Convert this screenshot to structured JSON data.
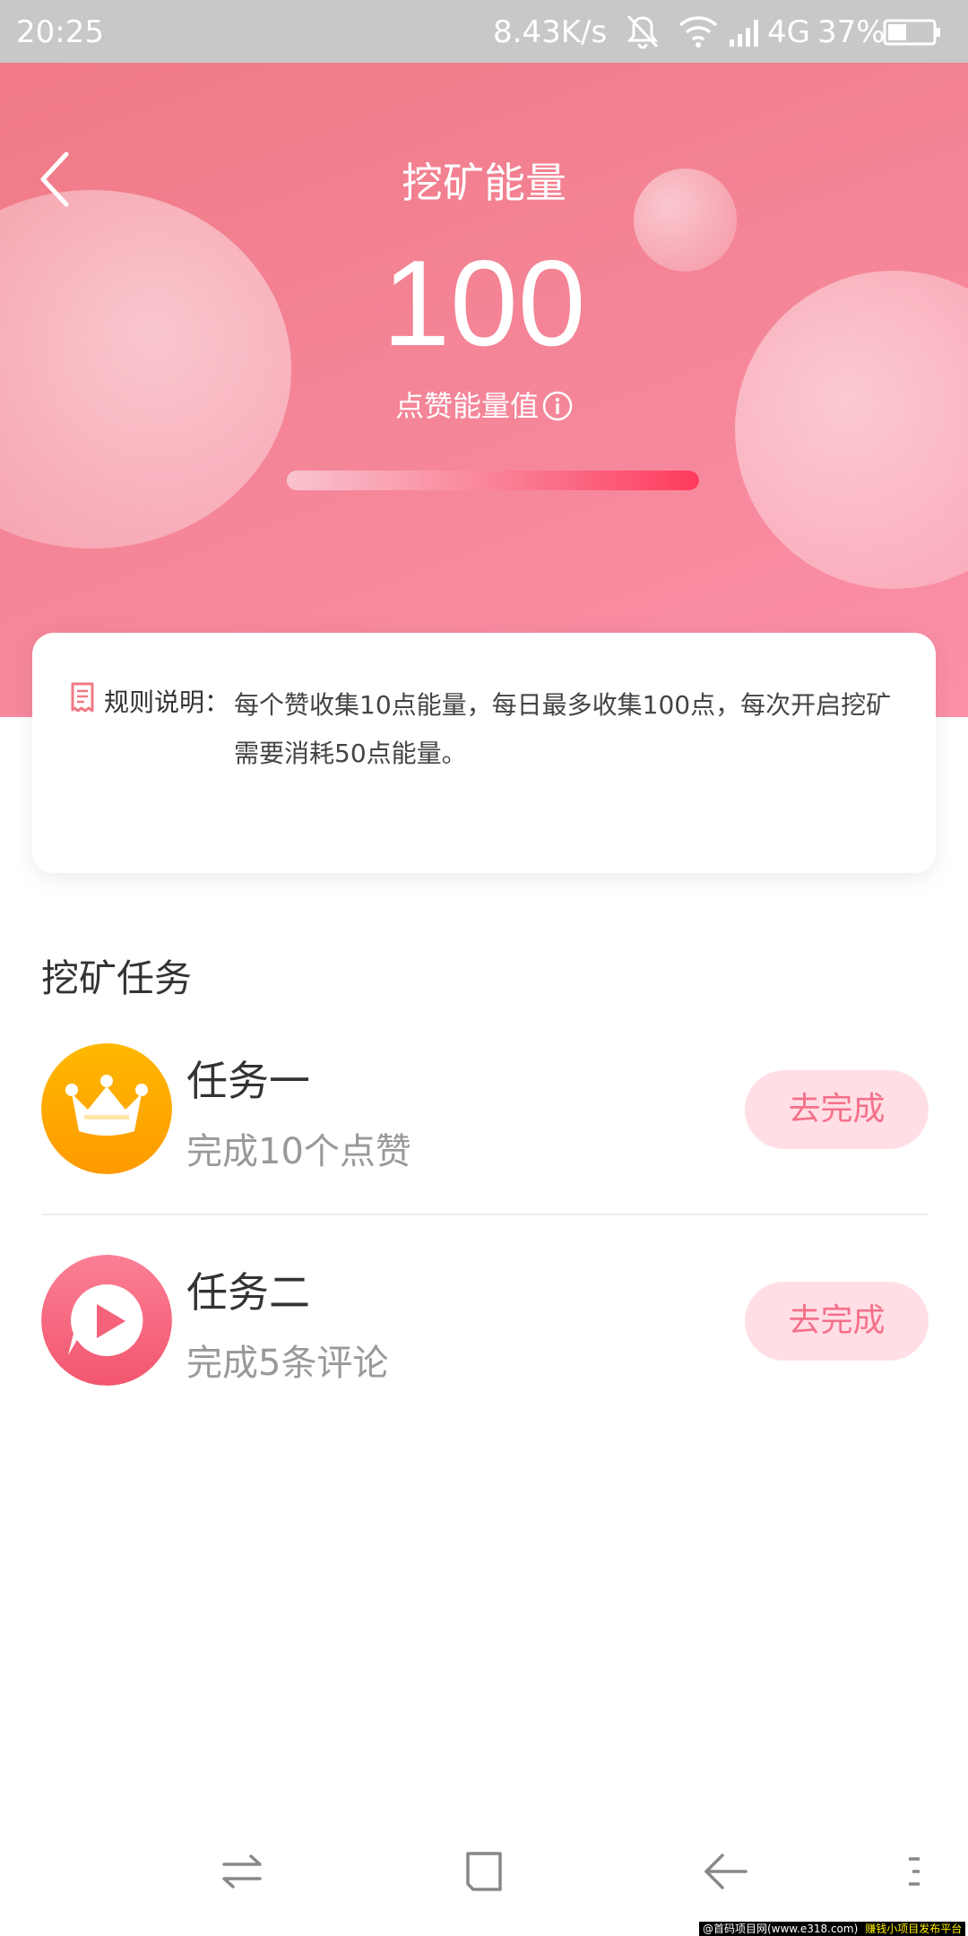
{
  "status_bar": {
    "time": "20:25",
    "speed": "8.43K/s",
    "network": "4G",
    "battery": "37%"
  },
  "header": {
    "title": "挖矿能量",
    "energy_value": "100",
    "energy_label": "点赞能量值",
    "progress_fraction": 1.0,
    "colors": {
      "gradient_start": "#f07a86",
      "gradient_end": "#fb90a8"
    }
  },
  "rules": {
    "label": "规则说明：",
    "text": "每个赞收集10点能量，每日最多收集100点，每次开启挖矿需要消耗50点能量。"
  },
  "tasks": {
    "section_title": "挖矿任务",
    "items": [
      {
        "title": "任务一",
        "desc": "完成10个点赞",
        "button": "去完成",
        "icon": "crown-icon"
      },
      {
        "title": "任务二",
        "desc": "完成5条评论",
        "button": "去完成",
        "icon": "play-bubble-icon"
      }
    ]
  },
  "watermark": {
    "text1": "@首码项目网(www.e318.com)",
    "text2": "赚钱小项目发布平台"
  }
}
